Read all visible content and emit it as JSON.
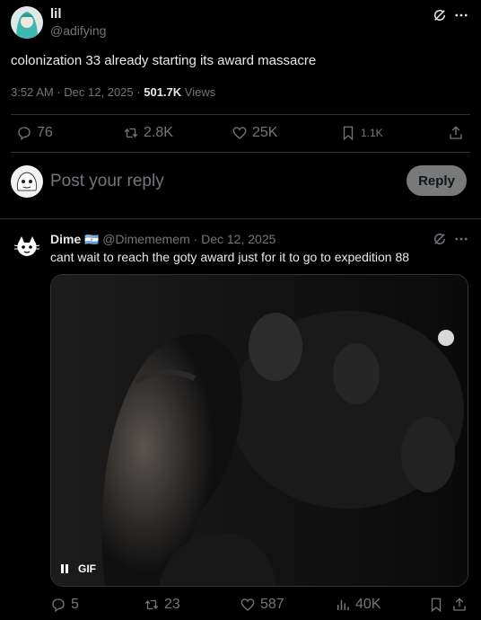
{
  "post": {
    "display_name": "lil",
    "handle": "@adifying",
    "text": "colonization 33 already starting its award massacre",
    "time": "3:52 AM",
    "date": "Dec 12, 2025",
    "views_count": "501.7K",
    "views_label": "Views",
    "stats": {
      "replies": "76",
      "reposts": "2.8K",
      "likes": "25K",
      "bookmarks": "1.1K"
    }
  },
  "composer": {
    "placeholder": "Post your reply",
    "reply_label": "Reply"
  },
  "reply": {
    "display_name": "Dime",
    "flag": "🇦🇷",
    "handle": "@Dimememem",
    "date": "Dec 12, 2025",
    "text": "cant wait to reach the goty award just for it to go to expedition 88",
    "media": {
      "badge": "GIF",
      "pause_icon": "pause-icon"
    },
    "stats": {
      "replies": "5",
      "reposts": "23",
      "likes": "587",
      "views": "40K"
    }
  },
  "colors": {
    "background": "#000000",
    "text": "#e7e9ea",
    "muted": "#71767b",
    "divider": "#2f3336",
    "reply_button": "#787a7a"
  }
}
